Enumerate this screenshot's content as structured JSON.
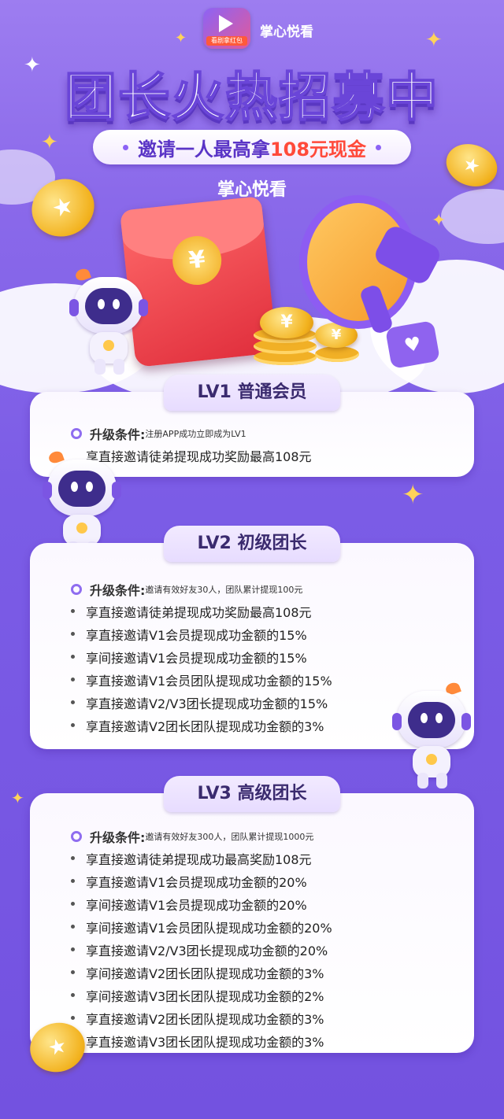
{
  "header": {
    "app_name": "掌心悦看",
    "app_logo_tag": "看剧拿红包",
    "title": "团长火热招募中",
    "subtitle_prefix": "邀请一人最高拿",
    "subtitle_highlight": "108元现金",
    "brand_line": "掌心悦看"
  },
  "illustration": {
    "seal_glyph": "¥",
    "coin_glyph": "★",
    "chat_icon": "heart-chat-icon"
  },
  "levels": [
    {
      "title": "LV1  普通会员",
      "condition_label": "升级条件:",
      "condition_value": "注册APP成功立即成为LV1",
      "items": [
        "享直接邀请徒弟提现成功奖励最高108元"
      ]
    },
    {
      "title": "LV2  初级团长",
      "condition_label": "升级条件:",
      "condition_value": "邀请有效好友30人，团队累计提现100元",
      "items": [
        "享直接邀请徒弟提现成功奖励最高108元",
        "享直接邀请V1会员提现成功金额的15%",
        "享间接邀请V1会员提现成功金额的15%",
        "享直接邀请V1会员团队提现成功金额的15%",
        "享直接邀请V2/V3团长提现成功金额的15%",
        "享直接邀请V2团长团队提现成功金额的3%"
      ]
    },
    {
      "title": "LV3  高级团长",
      "condition_label": "升级条件:",
      "condition_value": "邀请有效好友300人，团队累计提现1000元",
      "items": [
        "享直接邀请徒弟提现成功最高奖励108元",
        "享直接邀请V1会员提现成功金额的20%",
        "享间接邀请V1会员提现成功金额的20%",
        "享间接邀请V1会员团队提现成功金额的20%",
        "享直接邀请V2/V3团长提现成功金额的20%",
        "享间接邀请V2团长团队提现成功金额的3%",
        "享间接邀请V3团长团队提现成功金额的2%",
        "享直接邀请V2团长团队提现成功金额的3%",
        "享直接邀请V3团长团队提现成功金额的3%"
      ]
    }
  ]
}
